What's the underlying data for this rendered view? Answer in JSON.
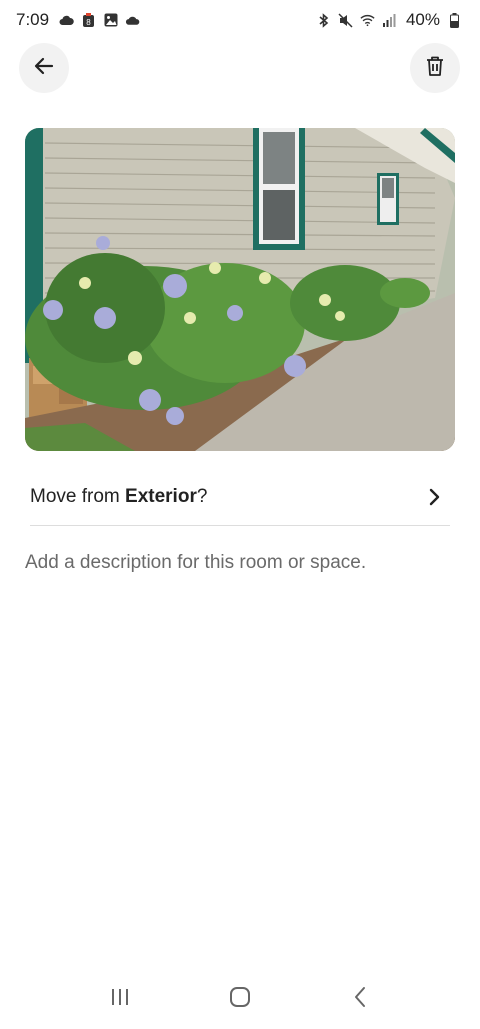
{
  "status_bar": {
    "time": "7:09",
    "battery": "40%",
    "left_icons": [
      "cloud-icon",
      "notification-badge-icon",
      "image-icon",
      "cloud-icon"
    ],
    "right_icons": [
      "bluetooth-icon",
      "mute-icon",
      "wifi-icon",
      "signal-icon",
      "battery-icon"
    ]
  },
  "toolbar": {
    "back_icon": "back-arrow-icon",
    "delete_icon": "trash-icon"
  },
  "photo": {
    "subject": "photo-thumbnail"
  },
  "move_row": {
    "prefix": "Move from ",
    "room": "Exterior",
    "suffix": "?"
  },
  "description": {
    "placeholder": "Add a description for this room or space."
  },
  "nav_bar": {
    "recents_icon": "recents-icon",
    "home_icon": "home-icon",
    "back_icon": "nav-back-icon"
  },
  "colors": {
    "background": "#ffffff",
    "button_bg": "#f2f2f2",
    "text": "#222222",
    "placeholder": "#6a6a6a",
    "divider": "#dddddd"
  }
}
